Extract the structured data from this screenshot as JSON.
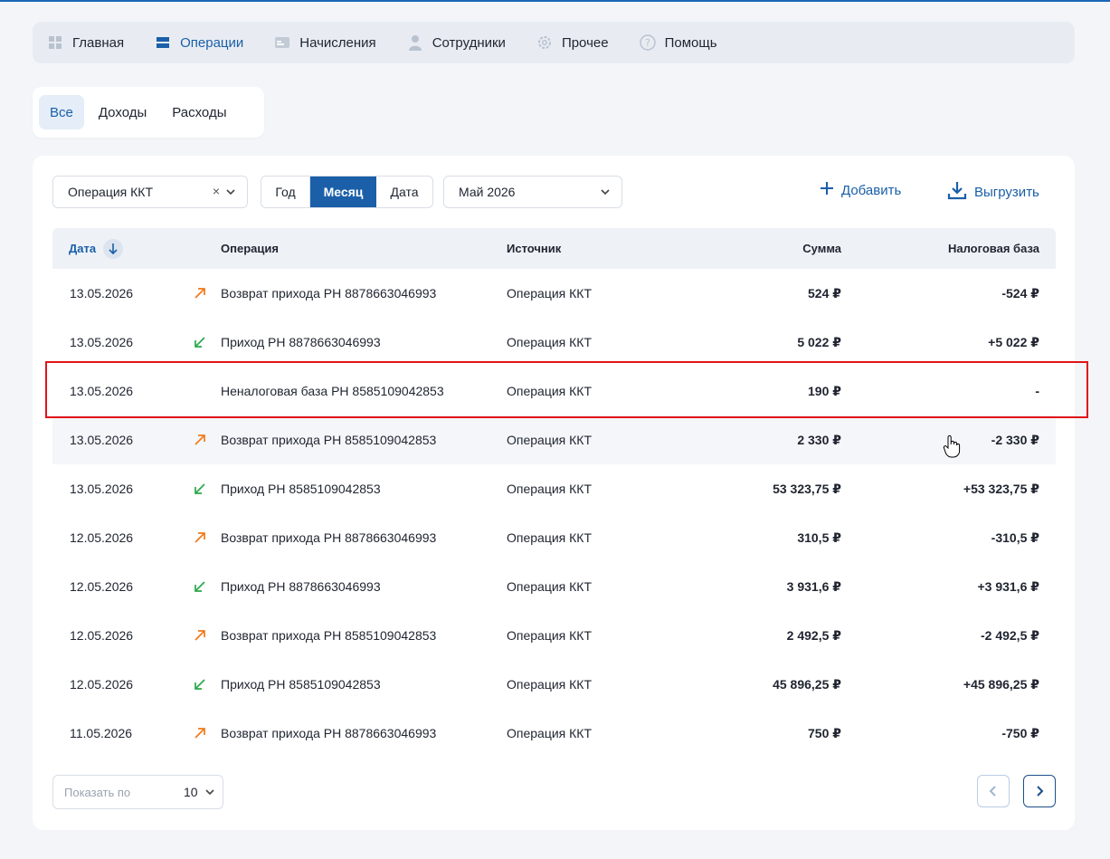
{
  "nav": {
    "items": [
      {
        "label": "Главная",
        "icon": "dashboard-icon"
      },
      {
        "label": "Операции",
        "icon": "operations-icon"
      },
      {
        "label": "Начисления",
        "icon": "card-icon"
      },
      {
        "label": "Сотрудники",
        "icon": "person-icon"
      },
      {
        "label": "Прочее",
        "icon": "gear-icon"
      },
      {
        "label": "Помощь",
        "icon": "help-icon"
      }
    ],
    "active": "Операции"
  },
  "tabs": {
    "items": [
      "Все",
      "Доходы",
      "Расходы"
    ],
    "active": "Все"
  },
  "filters": {
    "source_value": "Операция ККТ",
    "period": {
      "options": [
        "Год",
        "Месяц",
        "Дата"
      ],
      "active": "Месяц"
    },
    "month_value": "Май 2026",
    "add_label": "Добавить",
    "export_label": "Выгрузить"
  },
  "table": {
    "headers": {
      "date": "Дата",
      "operation": "Операция",
      "source": "Источник",
      "amount": "Сумма",
      "tax_base": "Налоговая база"
    },
    "rows": [
      {
        "date": "13.05.2026",
        "dir": "out",
        "operation": "Возврат прихода РН 8878663046993",
        "source": "Операция ККТ",
        "amount": "524 ₽",
        "tax": "-524 ₽"
      },
      {
        "date": "13.05.2026",
        "dir": "in",
        "operation": "Приход РН 8878663046993",
        "source": "Операция ККТ",
        "amount": "5 022 ₽",
        "tax": "+5 022 ₽"
      },
      {
        "date": "13.05.2026",
        "dir": "none",
        "operation": "Неналоговая база РН 8585109042853",
        "source": "Операция ККТ",
        "amount": "190 ₽",
        "tax": "-"
      },
      {
        "date": "13.05.2026",
        "dir": "out",
        "operation": "Возврат прихода РН 8585109042853",
        "source": "Операция ККТ",
        "amount": "2 330 ₽",
        "tax": "-2 330 ₽"
      },
      {
        "date": "13.05.2026",
        "dir": "in",
        "operation": "Приход РН 8585109042853",
        "source": "Операция ККТ",
        "amount": "53 323,75 ₽",
        "tax": "+53 323,75 ₽"
      },
      {
        "date": "12.05.2026",
        "dir": "out",
        "operation": "Возврат прихода РН 8878663046993",
        "source": "Операция ККТ",
        "amount": "310,5 ₽",
        "tax": "-310,5 ₽"
      },
      {
        "date": "12.05.2026",
        "dir": "in",
        "operation": "Приход РН 8878663046993",
        "source": "Операция ККТ",
        "amount": "3 931,6 ₽",
        "tax": "+3 931,6 ₽"
      },
      {
        "date": "12.05.2026",
        "dir": "out",
        "operation": "Возврат прихода РН 8585109042853",
        "source": "Операция ККТ",
        "amount": "2 492,5 ₽",
        "tax": "-2 492,5 ₽"
      },
      {
        "date": "12.05.2026",
        "dir": "in",
        "operation": "Приход РН 8585109042853",
        "source": "Операция ККТ",
        "amount": "45 896,25 ₽",
        "tax": "+45 896,25 ₽"
      },
      {
        "date": "11.05.2026",
        "dir": "out",
        "operation": "Возврат прихода РН 8878663046993",
        "source": "Операция ККТ",
        "amount": "750 ₽",
        "tax": "-750 ₽"
      }
    ]
  },
  "pagination": {
    "page_size_label": "Показать по",
    "page_size_value": "10"
  },
  "colors": {
    "accent": "#1a5fa8",
    "income_arrow": "#2aa84a",
    "refund_arrow": "#f07a1a",
    "highlight": "#e0141a"
  }
}
